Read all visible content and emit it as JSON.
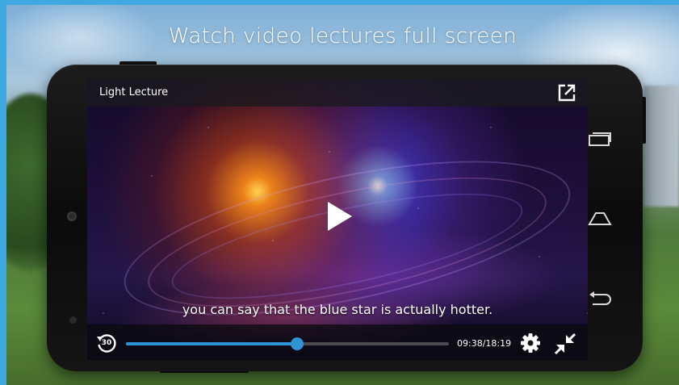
{
  "headline": "Watch video lectures full screen",
  "player": {
    "title": "Light Lecture",
    "subtitle": "you can say that the blue star is actually hotter.",
    "rewind_seconds": "30",
    "time": "09:38/18:19",
    "progress_fraction": 0.53,
    "accent_color": "#2f94d6"
  },
  "icons": {
    "popout": "external-link-icon",
    "play": "play-icon",
    "rewind": "rewind-30-icon",
    "settings": "gear-icon",
    "exit_fullscreen": "exit-fullscreen-icon",
    "recents": "recent-apps-icon",
    "home": "home-icon",
    "back": "back-icon"
  }
}
